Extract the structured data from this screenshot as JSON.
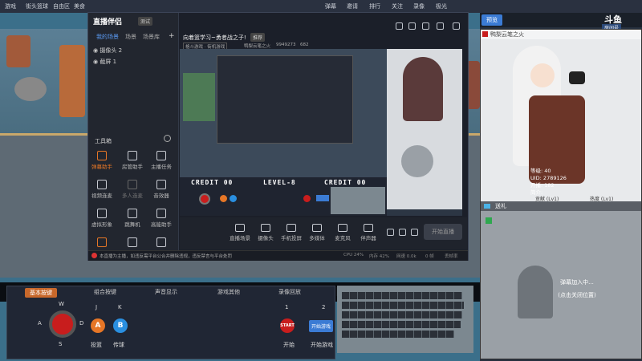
{
  "browser": {
    "nav": [
      "游戏",
      "街头篮球",
      "自由区",
      "美食"
    ],
    "right_items": [
      "弹幕",
      "邀请",
      "排行",
      "关注",
      "录像",
      "极光"
    ]
  },
  "game": {
    "credit_left": "CREDIT 00",
    "level": "LEVEL-8",
    "credit_right": "CREDIT 00"
  },
  "control_panel": {
    "tabs": [
      "基本按键",
      "组合按键",
      "声音显示",
      "游戏其他",
      "录像回放"
    ],
    "dpad": {
      "up": "W",
      "left": "A",
      "down": "S",
      "right": "D"
    },
    "keys": {
      "j": "J",
      "k": "K",
      "a_btn": "A",
      "b_btn": "B",
      "n1": "1",
      "n2": "2"
    },
    "labels": {
      "attack": "投篮",
      "pass": "传球",
      "start": "开始",
      "start_game": "开始游戏"
    },
    "start_badge": "START",
    "start_game_btn": "开始游戏"
  },
  "obs": {
    "title": "直播伴侣",
    "badge": "测试",
    "left_tabs": [
      "我的场景",
      "场景",
      "场景库"
    ],
    "add": "+",
    "layers": [
      "摄像头 2",
      "截屏 1"
    ],
    "tools_title": "工具箱",
    "tools": [
      [
        "弹幕助手",
        "房管助手",
        "主播任务"
      ],
      [
        "视频连麦",
        "多人连麦",
        "音效器"
      ],
      [
        "虚拟形象",
        "跳舞机",
        "高能助手"
      ],
      [
        "",
        "",
        ""
      ]
    ],
    "stream_title": "向着篮学习~勇者战之子!",
    "stream_tag": "推荐",
    "game_tag": "格斗游戏 · 街机游戏",
    "anchor_name": "鸭梨云笔之火",
    "room_id": "9949273",
    "fans": "682",
    "bottom": [
      "直播场景",
      "摄像头",
      "手机投屏",
      "多媒体",
      "麦克风",
      "伴声器"
    ],
    "start_live": "开始直播",
    "status_msg": "本直播为主播，如违反需平台公合并删除违规，违反禁言与平台处罚",
    "status_right": [
      "CPU 24%",
      "内存 42%",
      "网速 0.0k",
      "0 帧",
      "丢帧率"
    ]
  },
  "right_panel": {
    "tab": "预览",
    "logo": "斗鱼",
    "room_label": "房间号",
    "room_no": "9949273",
    "uploader": "鸭梨云笔之火",
    "stats": [
      "等级: 40",
      "UID: 2789126",
      "开播: 182",
      "简介:"
    ],
    "popularity": "贡献 (Lv1)",
    "hot": "热度 (Lv1)",
    "gift": "送礼",
    "loading": "弹幕加入中...",
    "loading2": "(点击关闭位置)"
  },
  "colors": {
    "accent": "#c8682b",
    "blue": "#3b7bd4",
    "red": "#c81d1d"
  }
}
